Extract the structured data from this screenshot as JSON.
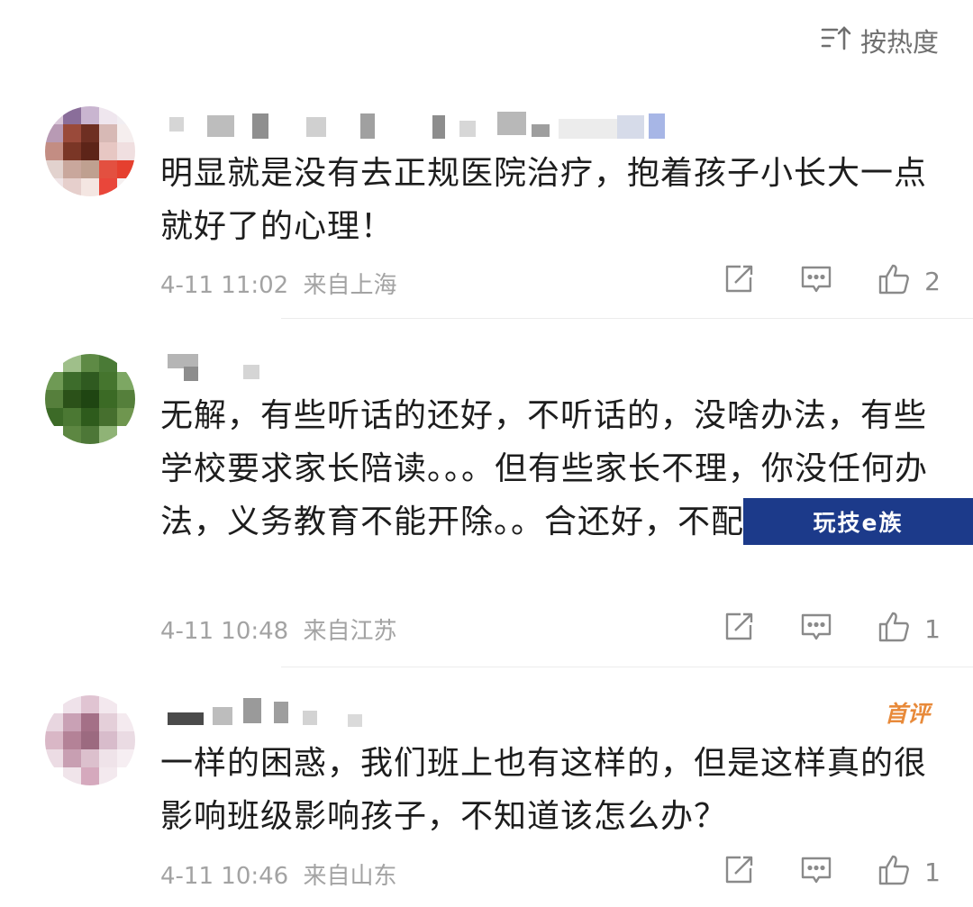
{
  "sort": {
    "label": "按热度",
    "icon": "sort-icon"
  },
  "comments": [
    {
      "text": "明显就是没有去正规医院治疗，抱着孩子小长大一点就好了的心理！",
      "time": "4-11 11:02",
      "location": "来自上海",
      "likes": "2"
    },
    {
      "text": "无解，有些听话的还好，不听话的，没啥办法，有些学校要求家长陪读。。。但有些家长不理，你没任何办法，义务教育不能开除。。合还好，不配合，无解",
      "time": "4-11 10:48",
      "location": "来自江苏",
      "likes": "1"
    },
    {
      "text": "一样的困惑，我们班上也有这样的，但是这样真的很影响班级影响孩子，不知道该怎么办？",
      "time": "4-11 10:46",
      "location": "来自山东",
      "likes": "1",
      "badge": "首评"
    }
  ],
  "watermark": "玩技e族",
  "colors": {
    "meta": "#a3a3a3",
    "badge": "#e88a3a",
    "watermark_bg": "#1c3a8a"
  }
}
